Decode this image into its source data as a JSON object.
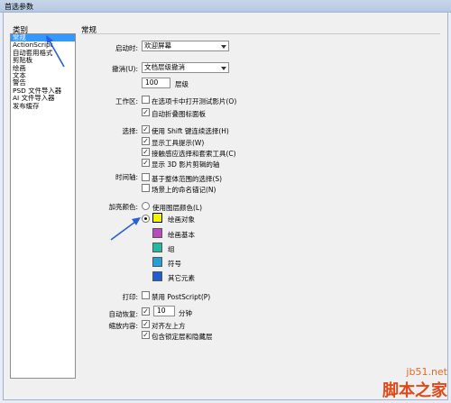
{
  "window": {
    "title": "首选参数"
  },
  "category": {
    "label": "类别",
    "items": [
      {
        "label": "常规",
        "selected": true
      },
      {
        "label": "ActionScript",
        "selected": false
      },
      {
        "label": "自动套用格式",
        "selected": false
      },
      {
        "label": "剪贴板",
        "selected": false
      },
      {
        "label": "绘画",
        "selected": false
      },
      {
        "label": "文本",
        "selected": false
      },
      {
        "label": "警告",
        "selected": false
      },
      {
        "label": "PSD 文件导入器",
        "selected": false
      },
      {
        "label": "AI 文件导入器",
        "selected": false
      },
      {
        "label": "发布缓存",
        "selected": false
      }
    ]
  },
  "section": {
    "title": "常规"
  },
  "startup": {
    "label": "启动时:",
    "value": "欢迎屏幕"
  },
  "undo": {
    "label": "撤消(U):",
    "value": "文档层级撤消",
    "levels_value": "100",
    "levels_label": "层级"
  },
  "workspace": {
    "label": "工作区:",
    "items": [
      {
        "label": "在选项卡中打开测试影片(O)",
        "checked": false
      },
      {
        "label": "自动折叠图标面板",
        "checked": true
      }
    ]
  },
  "selection": {
    "label": "选择:",
    "items": [
      {
        "label": "使用 Shift 键连续选择(H)",
        "checked": true
      },
      {
        "label": "显示工具提示(W)",
        "checked": true
      },
      {
        "label": "接触感应选择和套索工具(C)",
        "checked": true
      },
      {
        "label": "显示 3D 影片剪辑的轴",
        "checked": true
      }
    ]
  },
  "timeline": {
    "label": "时间轴:",
    "items": [
      {
        "label": "基于整体范围的选择(S)",
        "checked": false
      },
      {
        "label": "场景上的命名锚记(N)",
        "checked": false
      }
    ]
  },
  "highlight": {
    "label": "加亮颜色:",
    "use_layer_color": "使用图层颜色(L)",
    "options": [
      {
        "label": "绘画对象",
        "color": "#f4f400"
      },
      {
        "label": "绘画基本",
        "color": "#b84cb8"
      },
      {
        "label": "组",
        "color": "#28b8a0"
      },
      {
        "label": "符号",
        "color": "#24a0d8"
      },
      {
        "label": "其它元素",
        "color": "#1e5cd8"
      }
    ]
  },
  "print": {
    "label": "打印:",
    "option": "禁用 PostScript(P)",
    "checked": false
  },
  "autorecovery": {
    "label": "自动恢复:",
    "value": "10",
    "unit": "分钟",
    "checked": true
  },
  "scale": {
    "label": "缩放内容:",
    "items": [
      {
        "label": "对齐左上方",
        "checked": true
      },
      {
        "label": "包含锁定层和隐藏层",
        "checked": true
      }
    ]
  },
  "watermark": {
    "line1": "jb51.net",
    "line2": "脚本之家"
  },
  "colors": {
    "accent": "#3399ff",
    "arrow": "#2a5fd6"
  }
}
